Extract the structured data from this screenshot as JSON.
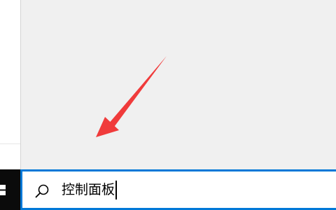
{
  "search": {
    "query": "控制面板",
    "icon": "search-icon"
  },
  "taskbar": {
    "start_icon": "windows-logo-icon",
    "accent_color": "#0078d7"
  },
  "annotation": {
    "type": "arrow",
    "color": "#f03b3b",
    "points_to": "lower-left"
  }
}
